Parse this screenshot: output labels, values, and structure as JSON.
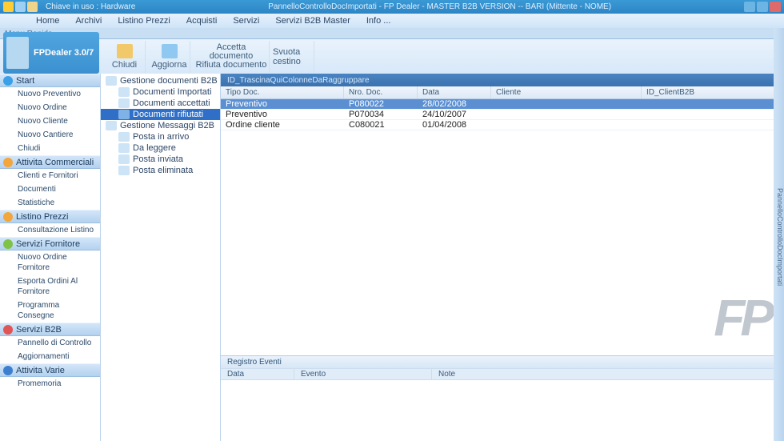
{
  "titlebar": {
    "chiave": "Chiave in uso : Hardware",
    "center": "PannelloControlloDocImportati - FP Dealer - MASTER B2B VERSION -- BARI (Mittente - NOME)"
  },
  "menu": [
    "Home",
    "Archivi",
    "Listino Prezzi",
    "Acquisti",
    "Servizi",
    "Servizi B2B Master",
    "Info ..."
  ],
  "ribbonTab": "Menu Rapido",
  "brand": "FPDealer 3.0/7",
  "ribbon": {
    "chiudi": "Chiudi",
    "aggiorna": "Aggiorna",
    "accetta": "Accetta documento",
    "rifiuta": "Rifiuta documento",
    "svuota": "Svuota cestino"
  },
  "nav": {
    "start": {
      "h": "Start",
      "items": [
        "Nuovo Preventivo",
        "Nuovo Ordine",
        "Nuovo Cliente",
        "Nuovo Cantiere",
        "Chiudi"
      ]
    },
    "att": {
      "h": "Attivita Commerciali",
      "items": [
        "Clienti e Fornitori",
        "Documenti",
        "Statistiche"
      ]
    },
    "listino": {
      "h": "Listino Prezzi",
      "items": [
        "Consultazione Listino"
      ]
    },
    "servf": {
      "h": "Servizi Fornitore",
      "items": [
        "Nuovo Ordine Fornitore",
        "Esporta Ordini Al Fornitore",
        "Programma Consegne"
      ]
    },
    "b2b": {
      "h": "Servizi B2B",
      "items": [
        "Pannello di Controllo",
        "Aggiornamenti"
      ]
    },
    "varie": {
      "h": "Attivita Varie",
      "items": [
        "Promemoria"
      ]
    }
  },
  "tree": {
    "root1": "Gestione documenti B2B",
    "r1items": [
      "Documenti Importati",
      "Documenti accettati",
      "Documenti rifiutati"
    ],
    "root2": "Gestione Messaggi B2B",
    "r2items": [
      "Posta in arrivo",
      "Da leggere",
      "Posta inviata",
      "Posta eliminata"
    ],
    "selected": "Documenti rifiutati"
  },
  "groupBar": "ID_TrascinaQuiColonneDaRaggruppare",
  "grid": {
    "headers": {
      "tipo": "Tipo Doc.",
      "nro": "Nro. Doc.",
      "data": "Data",
      "cliente": "Cliente",
      "idc": "ID_ClientB2B"
    },
    "rows": [
      {
        "tipo": "Preventivo",
        "nro": "P080022",
        "data": "28/02/2008",
        "cliente": "",
        "idc": "",
        "sel": true
      },
      {
        "tipo": "Preventivo",
        "nro": "P070034",
        "data": "24/10/2007",
        "cliente": "",
        "idc": "",
        "sel": false
      },
      {
        "tipo": "Ordine cliente",
        "nro": "C080021",
        "data": "01/04/2008",
        "cliente": "",
        "idc": "",
        "sel": false
      }
    ]
  },
  "events": {
    "title": "Registro Eventi",
    "cols": {
      "data": "Data",
      "evento": "Evento",
      "note": "Note"
    }
  },
  "rightstrip": "PannelloControlloDocImportati"
}
